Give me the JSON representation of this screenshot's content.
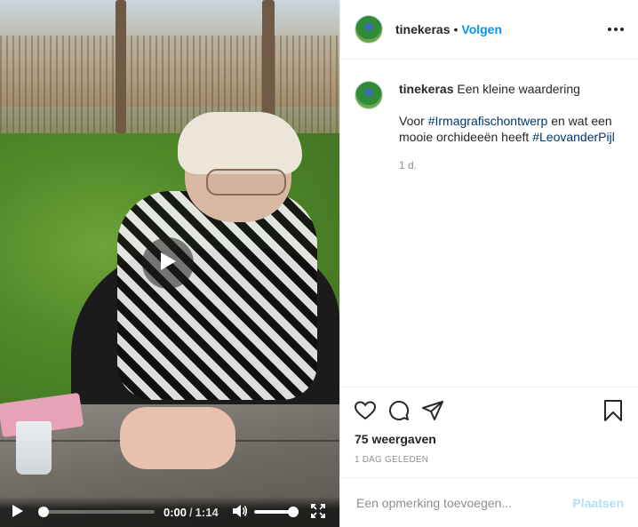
{
  "video": {
    "current_time": "0:00",
    "separator": "/",
    "duration": "1:14",
    "progress": 0.0,
    "volume": 1.0,
    "icons": {
      "play_overlay": "play-circle-icon",
      "play": "play-icon",
      "volume": "volume-icon",
      "fullscreen": "fullscreen-icon"
    }
  },
  "header": {
    "username": "tinekeras",
    "dot": "•",
    "follow_label": "Volgen",
    "more_icon": "more-options-icon"
  },
  "caption": {
    "username": "tinekeras",
    "title": "Een kleine waardering",
    "line_prefix": "Voor ",
    "hashtag1": "#Irmagrafischontwerp",
    "line_middle": " en wat een mooie orchideeën heeft ",
    "hashtag2": "#LeovanderPijl",
    "age": "1 d."
  },
  "actions": {
    "icons": [
      "heart-icon",
      "comment-icon",
      "share-icon",
      "bookmark-icon"
    ],
    "views": "75 weergaven",
    "posted": "1 DAG GELEDEN"
  },
  "comment_box": {
    "placeholder": "Een opmerking toevoegen...",
    "post_label": "Plaatsen"
  },
  "colors": {
    "link": "#0095f6",
    "hashtag": "#00376b",
    "muted": "#8e8e8e",
    "post_disabled": "#b2dffc"
  }
}
